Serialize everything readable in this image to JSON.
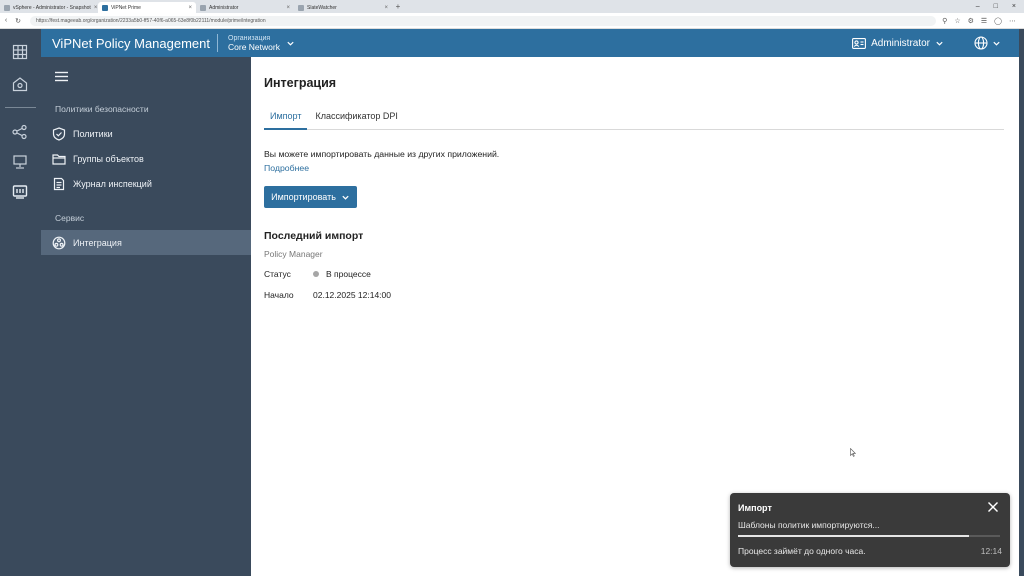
{
  "browser": {
    "tabs": [
      {
        "title": "vSphere - Administrator - Snapshot",
        "active": false
      },
      {
        "title": "ViPNet Prime",
        "active": true
      },
      {
        "title": "Administrator",
        "active": false
      },
      {
        "title": "SlateWatcher",
        "active": false
      }
    ],
    "url": "https://fest.mageeab.org/organization/2233a5b0-ff57-40f6-a065-63e8f0b22111/module/prime/integration"
  },
  "header": {
    "brand": "ViPNet Policy Management",
    "org_caption": "Организация",
    "org_value": "Core Network",
    "user": "Administrator"
  },
  "sidebar": {
    "section1_title": "Политики безопасности",
    "items1": [
      {
        "label": "Политики",
        "icon": "shield-icon"
      },
      {
        "label": "Группы объектов",
        "icon": "folder-icon"
      },
      {
        "label": "Журнал инспекций",
        "icon": "journal-icon"
      }
    ],
    "section2_title": "Сервис",
    "items2": [
      {
        "label": "Интеграция",
        "icon": "integration-icon",
        "active": true
      }
    ]
  },
  "main": {
    "title": "Интеграция",
    "tabs": [
      {
        "label": "Импорт",
        "active": true
      },
      {
        "label": "Классификатор DPI",
        "active": false
      }
    ],
    "info_text": "Вы можете импортировать данные из других приложений.",
    "more_link": "Подробнее",
    "import_button": "Импортировать",
    "last_import": {
      "title": "Последний импорт",
      "source": "Policy Manager",
      "status_label": "Статус",
      "status_value": "В процессе",
      "start_label": "Начало",
      "start_value": "02.12.2025 12:14:00"
    }
  },
  "toast": {
    "title": "Импорт",
    "message": "Шаблоны политик импортируются...",
    "progress": 0.88,
    "note": "Процесс займёт до одного часа.",
    "time": "12:14"
  },
  "colors": {
    "accent": "#2d6f9f",
    "sidebar": "#3a4a5c",
    "sidebar_active": "#56687c",
    "toast": "#3a3a3a"
  }
}
